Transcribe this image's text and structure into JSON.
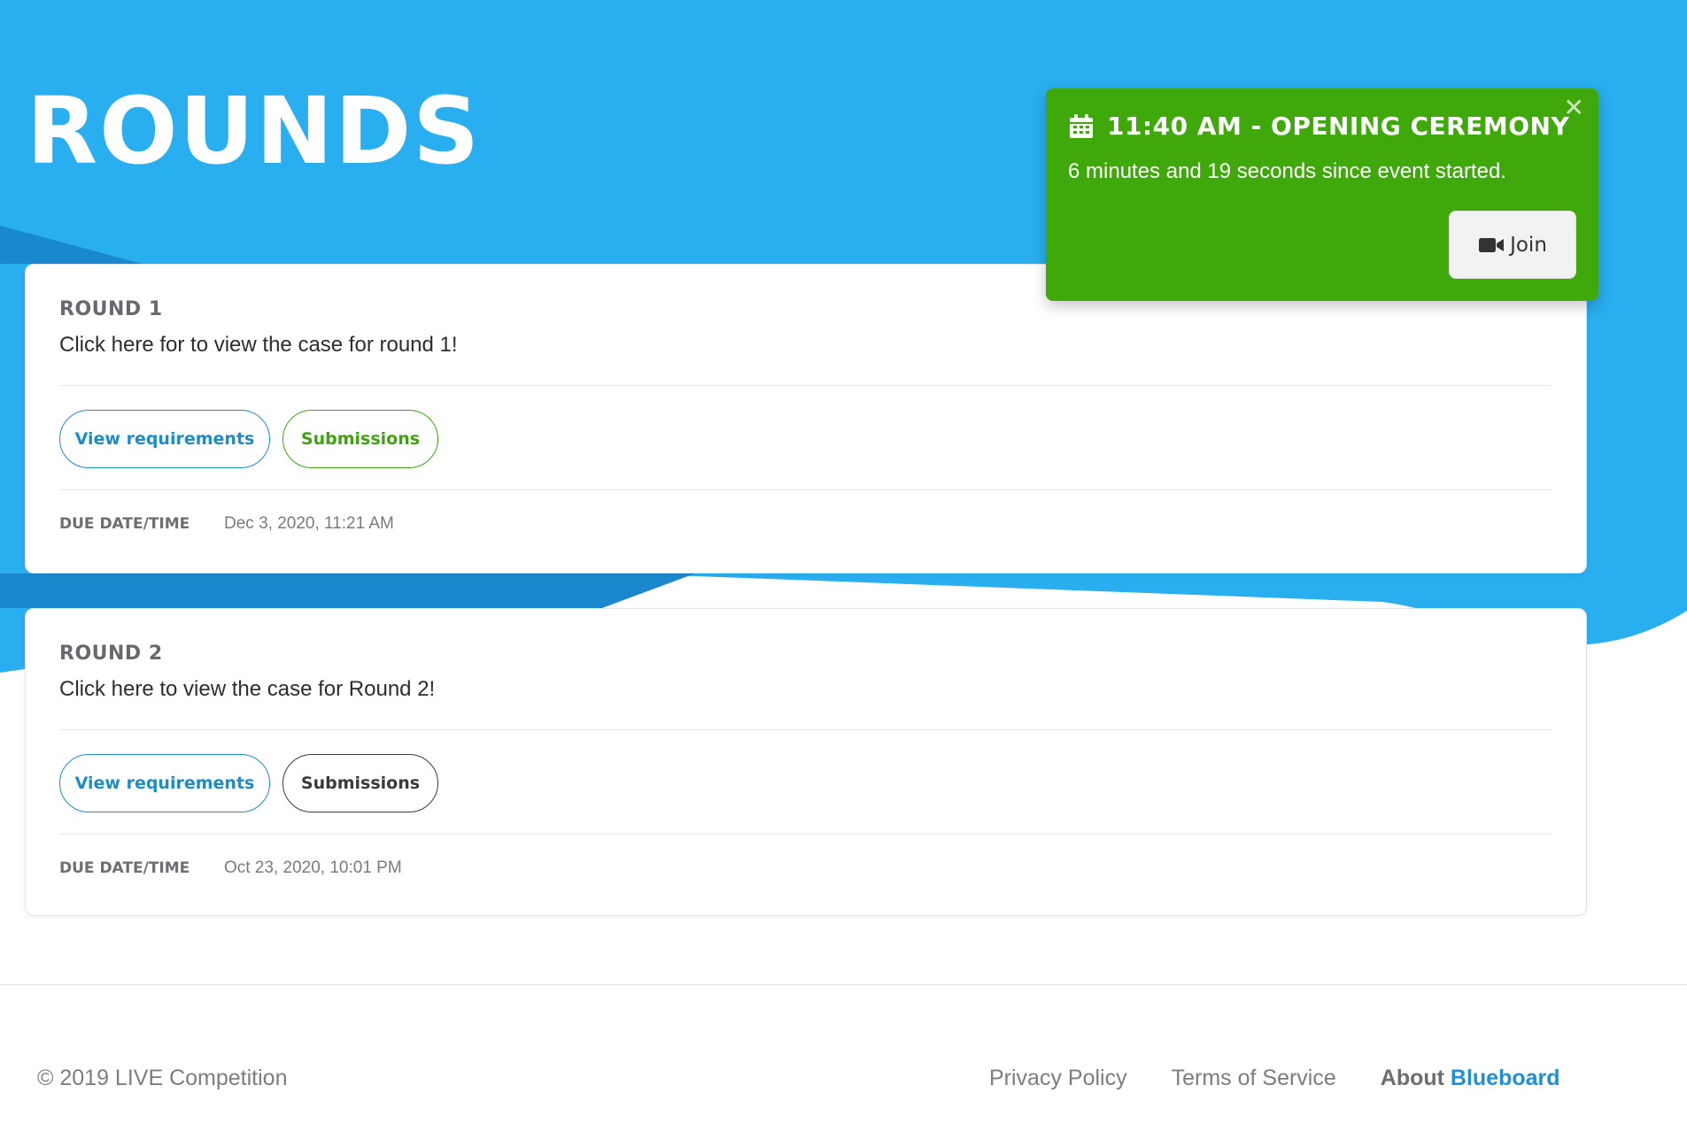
{
  "header": {
    "title": "ROUNDS"
  },
  "rounds": [
    {
      "title": "ROUND 1",
      "description": "Click here for to view the case for round 1!",
      "view_requirements_label": "View requirements",
      "submissions_label": "Submissions",
      "submissions_style": "green",
      "due_label": "DUE DATE/TIME",
      "due_value": "Dec 3, 2020, 11:21 AM"
    },
    {
      "title": "ROUND 2",
      "description": "Click here to view the case for Round 2!",
      "view_requirements_label": "View requirements",
      "submissions_label": "Submissions",
      "submissions_style": "dark",
      "due_label": "DUE DATE/TIME",
      "due_value": "Oct 23, 2020, 10:01 PM"
    }
  ],
  "notification": {
    "icon": "calendar-icon",
    "title": "11:40 AM - OPENING CEREMONY",
    "subtitle": "6 minutes and 19 seconds since event started.",
    "close_symbol": "✕",
    "join_label": "Join",
    "join_icon": "video-camera-icon"
  },
  "footer": {
    "copyright": "© 2019 LIVE Competition",
    "privacy_label": "Privacy Policy",
    "terms_label": "Terms of Service",
    "about_prefix": "About ",
    "about_brand": "Blueboard"
  },
  "colors": {
    "hero_blue": "#29aef0",
    "hero_dark_blue": "#1a88cc",
    "toast_green": "#3fa80a",
    "accent_blue": "#1b8dc7",
    "accent_green": "#3fa30f",
    "brand_blue": "#1f8fd6"
  }
}
